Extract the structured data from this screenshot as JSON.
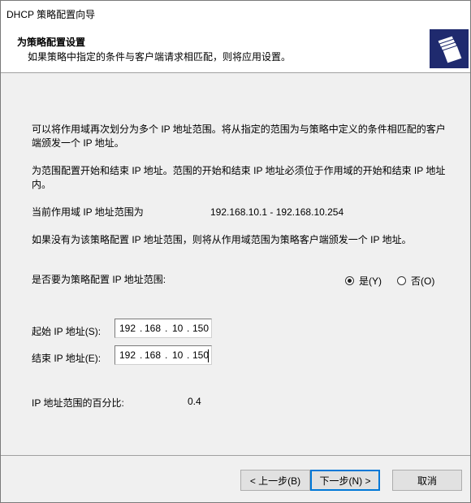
{
  "window": {
    "title": "DHCP 策略配置向导"
  },
  "header": {
    "title": "为策略配置设置",
    "subtitle": "如果策略中指定的条件与客户端请求相匹配，则将应用设置。",
    "icon": "folders-icon"
  },
  "body": {
    "para1_line1": "可以将作用域再次划分为多个 IP 地址范围。将从指定的范围为与策略中定义的条件相匹配的客户",
    "para1_line2": "端颁发一个 IP 地址。",
    "para2_line1": "为范围配置开始和结束 IP 地址。范围的开始和结束 IP 地址必须位于作用域的开始和结束 IP 地址",
    "para2_line2": "内。",
    "scope_label": "当前作用域 IP 地址范围为",
    "scope_value": "192.168.10.1 - 192.168.10.254",
    "para3": "如果没有为该策略配置 IP 地址范围，则将从作用域范围为策略客户端颁发一个 IP 地址。",
    "configure_question": "是否要为策略配置 IP 地址范围:",
    "radio_yes": "是(Y)",
    "radio_no": "否(O)",
    "selected": "yes"
  },
  "ip_fields": {
    "start_label": "起始 IP 地址(S):",
    "start": [
      "192",
      "168",
      "10",
      "150"
    ],
    "end_label": "结束 IP 地址(E):",
    "end": [
      "192",
      "168",
      "10",
      "150"
    ]
  },
  "percent": {
    "label": "IP 地址范围的百分比:",
    "value": "0.4"
  },
  "buttons": {
    "back": "< 上一步(B)",
    "next": "下一步(N) >",
    "cancel": "取消"
  }
}
